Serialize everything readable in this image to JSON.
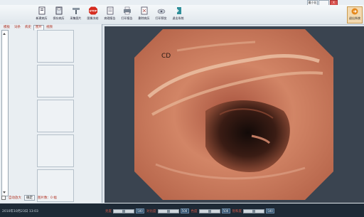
{
  "window": {
    "min_label": "最小化",
    "max_label": "",
    "close_label": "X"
  },
  "toolbar": {
    "items": [
      {
        "label": "新建病历",
        "icon": "new-record-icon"
      },
      {
        "label": "保存病历",
        "icon": "save-record-icon"
      },
      {
        "label": "采集图片",
        "icon": "capture-image-icon"
      },
      {
        "label": "图像冻结",
        "icon": "stop-icon"
      },
      {
        "label": "病理报告",
        "icon": "report-icon"
      },
      {
        "label": "打印报告",
        "icon": "print-icon"
      },
      {
        "label": "删除病历",
        "icon": "delete-icon"
      },
      {
        "label": "打印预览",
        "icon": "preview-icon"
      },
      {
        "label": "退出系统",
        "icon": "exit-system-icon"
      }
    ],
    "exit_label": "退出系统"
  },
  "left_panel": {
    "tabs": [
      "模板",
      "词条",
      "病史",
      "图片",
      "视频"
    ],
    "active_tab": 3,
    "footer": {
      "checkbox_label": "自动放大",
      "button_label": "确定",
      "count_label": "图片数：0 幅"
    }
  },
  "display": {
    "overlay_text": "CD",
    "colors": {
      "frame": "#3a4450",
      "tissue": "#c9755a",
      "lumen": "#241410"
    }
  },
  "statusbar": {
    "datetime": "2010年10月23日 13:03",
    "sliders": [
      {
        "name": "亮度",
        "value": "500"
      },
      {
        "name": "对比度",
        "value": "500"
      },
      {
        "name": "色度",
        "value": "500"
      },
      {
        "name": "饱和度",
        "value": "500"
      }
    ]
  }
}
